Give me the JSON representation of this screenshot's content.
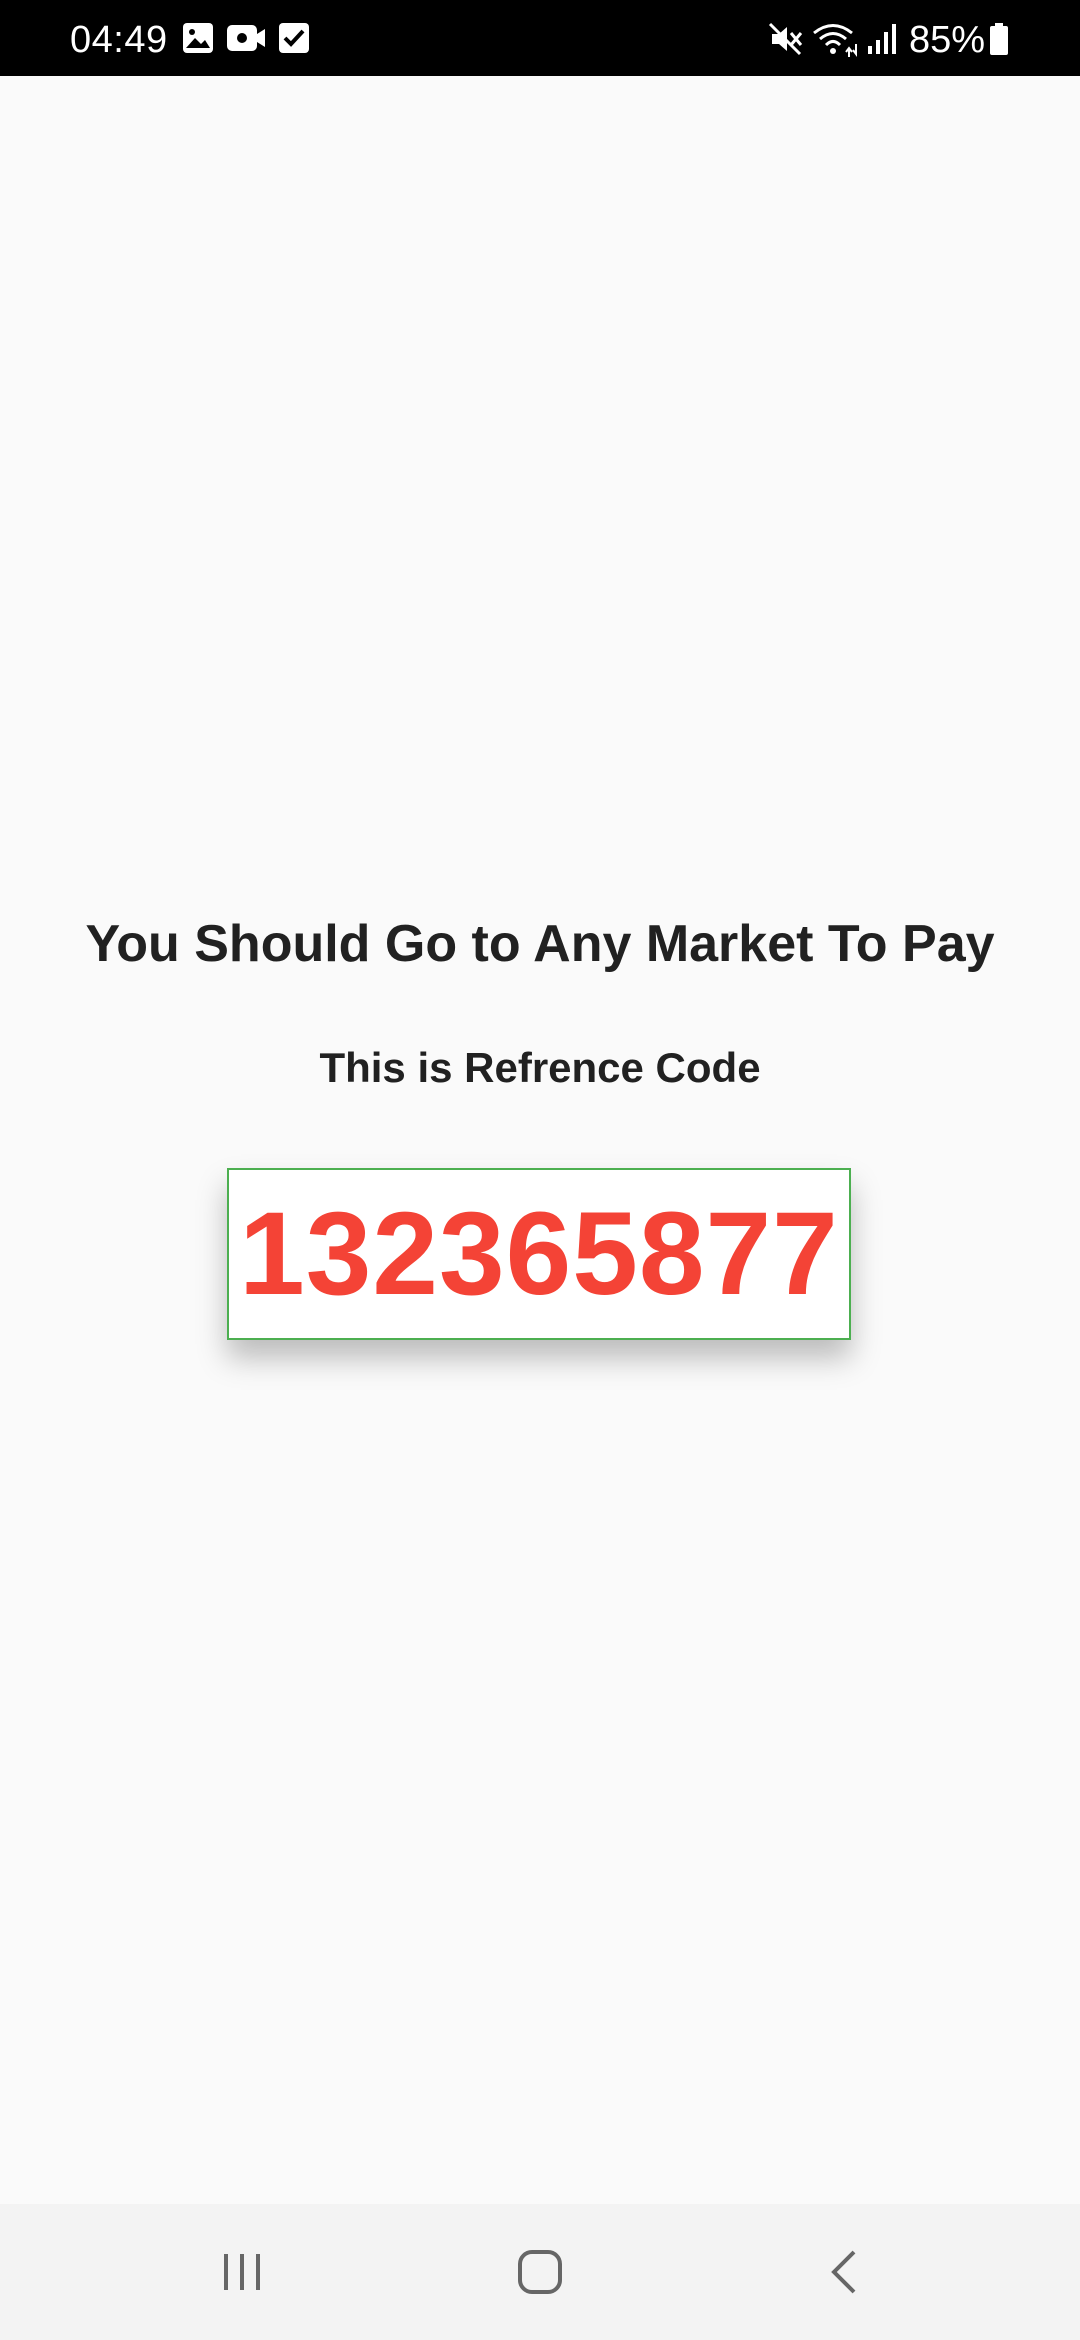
{
  "status_bar": {
    "time": "04:49",
    "battery_percent": "85%",
    "icons": [
      "image-icon",
      "video-camera-icon",
      "checkbox-icon",
      "mute-icon",
      "wifi-icon",
      "signal-icon",
      "battery-icon"
    ]
  },
  "main": {
    "title": "You Should Go to Any Market To Pay",
    "subtitle": "This is Refrence Code",
    "reference_code": "132365877"
  },
  "colors": {
    "code_text": "#f44336",
    "code_border": "#4caf50",
    "background": "#fafafa"
  },
  "nav_bar": {
    "icons": [
      "recent-apps-icon",
      "home-icon",
      "back-icon"
    ]
  }
}
